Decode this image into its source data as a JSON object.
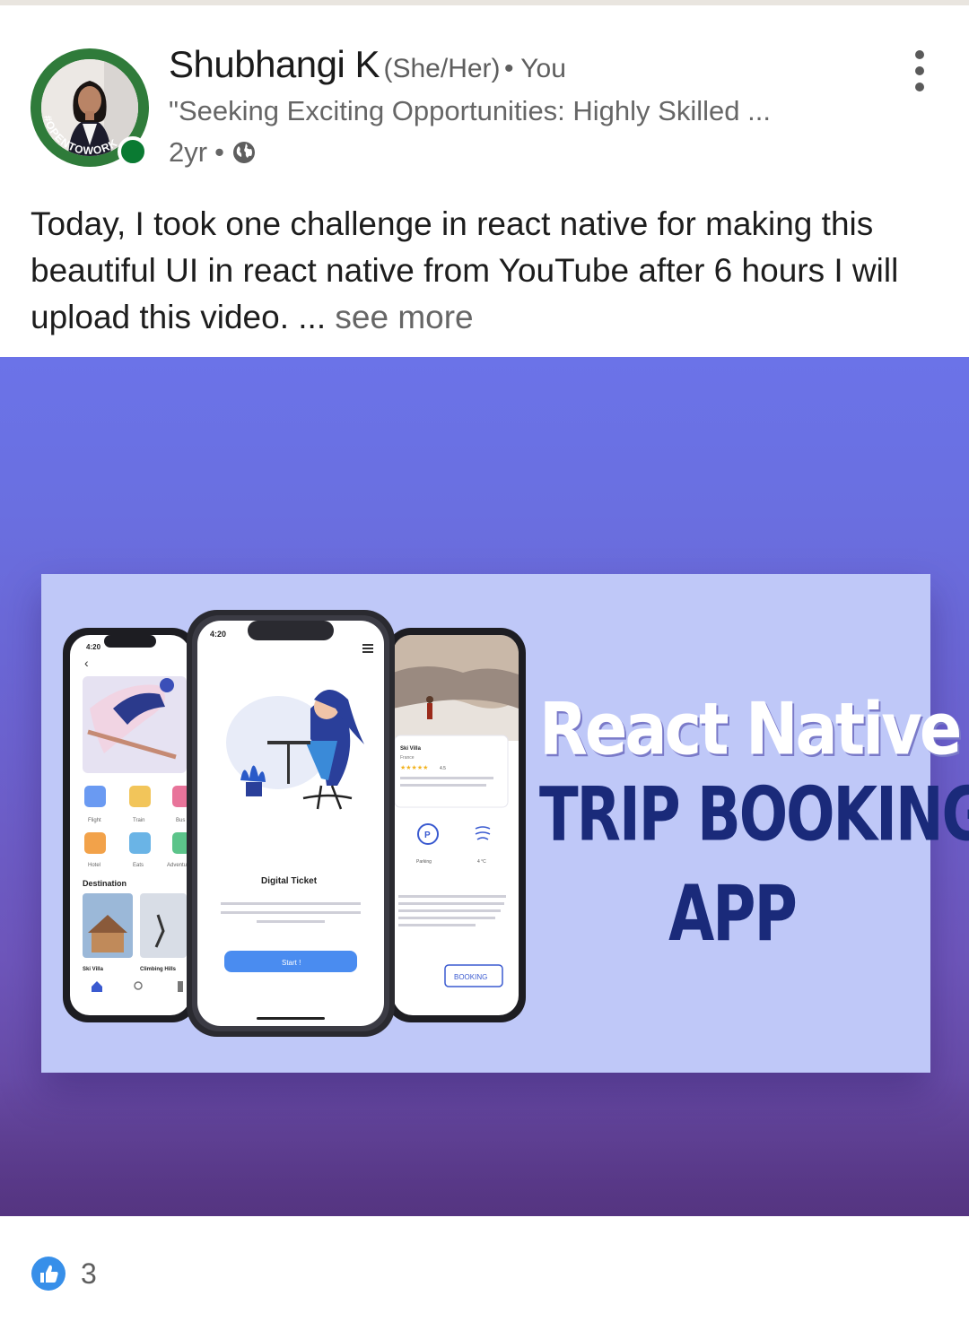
{
  "post": {
    "author": {
      "name": "Shubhangi K",
      "pronouns": "(She/Her)",
      "connection": "• You",
      "headline": "\"Seeking Exciting Opportunities: Highly Skilled ...",
      "time": "2yr",
      "time_separator": "•",
      "badge_text": "#OPENTOWORK",
      "online": true
    },
    "text": "Today, I took one challenge in react native for making this beautiful UI in  react native from YouTube after 6 hours I will upload this video. ...",
    "see_more_label": "see more",
    "media": {
      "title_line1": "React Native",
      "title_line2": "TRIP BOOKING",
      "title_line3": "APP",
      "phone_left": {
        "time": "4:20",
        "categories": [
          "Flight",
          "Train",
          "Bus",
          "Hotel",
          "Eats",
          "Adventure"
        ],
        "section": "Destination",
        "cards": [
          "Ski Villa",
          "Climbing Hills"
        ]
      },
      "phone_center": {
        "time": "4:20",
        "title": "Digital Ticket",
        "description": "Easy solution to buy tickets for your travel, business trips, transportation, lodging and culinary.",
        "button": "Start !"
      },
      "phone_right": {
        "place": "Ski Villa",
        "region": "France",
        "rating": "4.5",
        "feature": "Parking",
        "temperature": "4 °C",
        "button": "BOOKING"
      }
    },
    "reactions": {
      "count": "3",
      "icon": "like-icon"
    }
  },
  "colors": {
    "online_dot": "#0a7a32",
    "badge_ring": "#2f7b3a",
    "media_top": "#6b73e8",
    "media_bottom": "#603f91",
    "title_dark": "#1a2a7a",
    "like_blue": "#378fe9"
  }
}
